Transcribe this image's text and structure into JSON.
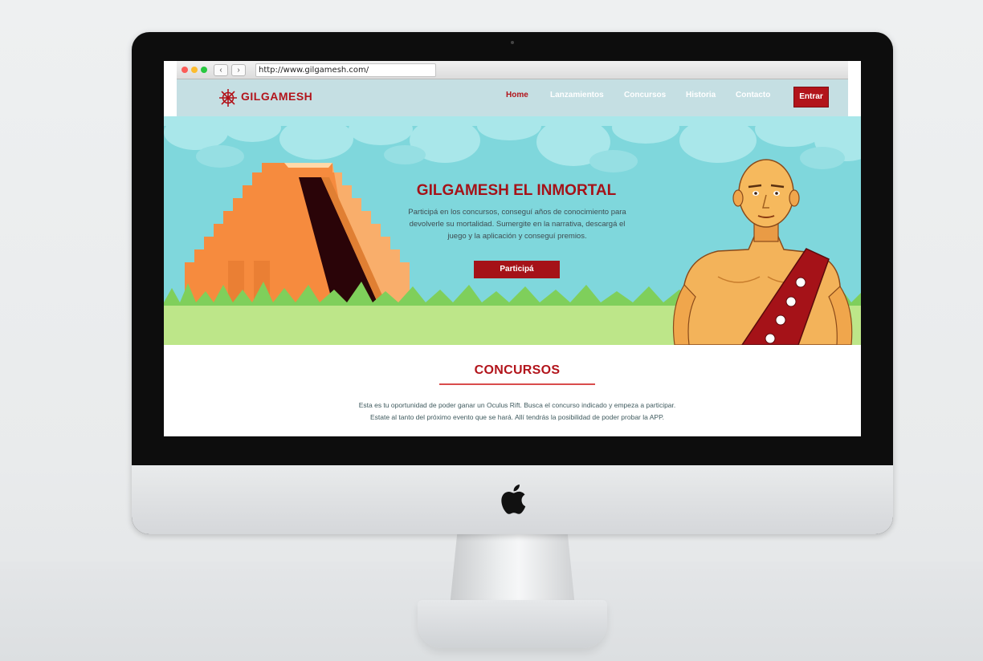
{
  "browser": {
    "url": "http://www.gilgamesh.com/",
    "back_glyph": "‹",
    "forward_glyph": "›"
  },
  "brand": {
    "name": "GILGAMESH",
    "accent_color": "#b2141b"
  },
  "nav": {
    "items": [
      {
        "label": "Home",
        "active": true
      },
      {
        "label": "Lanzamientos",
        "active": false
      },
      {
        "label": "Concursos",
        "active": false
      },
      {
        "label": "Historia",
        "active": false
      },
      {
        "label": "Contacto",
        "active": false
      }
    ],
    "enter_label": "Entrar"
  },
  "hero": {
    "title": "GILGAMESH EL INMORTAL",
    "text_lines": [
      "Participá en los concursos, conseguí años de conocimiento para",
      "devolverle su mortalidad. Sumergite en la narrativa, descargá el",
      "juego y la aplicación y conseguí premios."
    ],
    "cta_label": "Participá"
  },
  "concursos": {
    "title": "CONCURSOS",
    "text_lines": [
      "Esta es tu oportunidad de poder ganar un Oculus Rift. Busca el concurso indicado y empeza a participar.",
      "Estate al tanto del próximo evento que se hará. Allí tendrás la posibilidad de poder probar la APP."
    ]
  },
  "icons": [
    "star-logo-icon",
    "apple-logo-icon",
    "pyramid-illustration",
    "warrior-illustration"
  ]
}
